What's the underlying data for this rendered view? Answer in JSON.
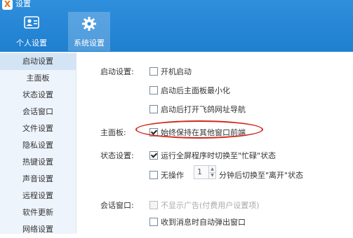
{
  "window": {
    "title": "设置",
    "logo_char": "X"
  },
  "tabs": [
    {
      "label": "个人设置",
      "icon": "user-card-icon"
    },
    {
      "label": "系统设置",
      "icon": "gear-icon"
    }
  ],
  "sidebar": {
    "items": [
      {
        "label": "启动设置"
      },
      {
        "label": "主面板"
      },
      {
        "label": "状态设置"
      },
      {
        "label": "会话窗口"
      },
      {
        "label": "文件设置"
      },
      {
        "label": "隐私设置"
      },
      {
        "label": "热键设置"
      },
      {
        "label": "声音设置"
      },
      {
        "label": "远程设置"
      },
      {
        "label": "软件更新"
      },
      {
        "label": "网络设置"
      }
    ]
  },
  "sections": {
    "startup": {
      "label": "启动设置:",
      "options": [
        {
          "label": "开机启动",
          "checked": false
        },
        {
          "label": "启动后主面板最小化",
          "checked": false
        },
        {
          "label": "启动后打开飞鸽网址导航",
          "checked": false
        }
      ]
    },
    "main_panel": {
      "label": "主面板:",
      "options": [
        {
          "label": "始终保持在其他窗口前端",
          "checked": true
        }
      ]
    },
    "status": {
      "label": "状态设置:",
      "fullscreen_label": "运行全屏程序时切换至\"忙碌\"状态",
      "idle_prefix": "无操作",
      "idle_minutes": "1",
      "idle_suffix": "分钟后切换至\"离开\"状态"
    },
    "chat": {
      "label": "会话窗口:",
      "options": [
        {
          "label": "不显示广告(付费用户设置项)",
          "checked": false,
          "disabled": true
        },
        {
          "label": "收到消息时自动弹出窗口",
          "checked": false
        }
      ]
    }
  }
}
